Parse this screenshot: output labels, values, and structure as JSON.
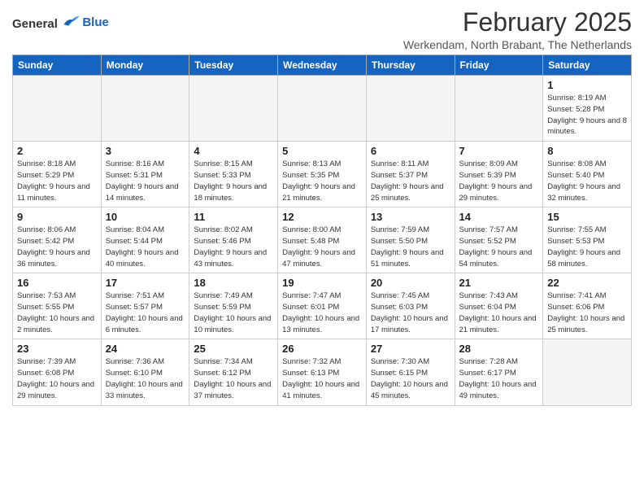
{
  "header": {
    "logo_general": "General",
    "logo_blue": "Blue",
    "month": "February 2025",
    "location": "Werkendam, North Brabant, The Netherlands"
  },
  "days_of_week": [
    "Sunday",
    "Monday",
    "Tuesday",
    "Wednesday",
    "Thursday",
    "Friday",
    "Saturday"
  ],
  "weeks": [
    [
      {
        "day": "",
        "info": ""
      },
      {
        "day": "",
        "info": ""
      },
      {
        "day": "",
        "info": ""
      },
      {
        "day": "",
        "info": ""
      },
      {
        "day": "",
        "info": ""
      },
      {
        "day": "",
        "info": ""
      },
      {
        "day": "1",
        "info": "Sunrise: 8:19 AM\nSunset: 5:28 PM\nDaylight: 9 hours and 8 minutes."
      }
    ],
    [
      {
        "day": "2",
        "info": "Sunrise: 8:18 AM\nSunset: 5:29 PM\nDaylight: 9 hours and 11 minutes."
      },
      {
        "day": "3",
        "info": "Sunrise: 8:16 AM\nSunset: 5:31 PM\nDaylight: 9 hours and 14 minutes."
      },
      {
        "day": "4",
        "info": "Sunrise: 8:15 AM\nSunset: 5:33 PM\nDaylight: 9 hours and 18 minutes."
      },
      {
        "day": "5",
        "info": "Sunrise: 8:13 AM\nSunset: 5:35 PM\nDaylight: 9 hours and 21 minutes."
      },
      {
        "day": "6",
        "info": "Sunrise: 8:11 AM\nSunset: 5:37 PM\nDaylight: 9 hours and 25 minutes."
      },
      {
        "day": "7",
        "info": "Sunrise: 8:09 AM\nSunset: 5:39 PM\nDaylight: 9 hours and 29 minutes."
      },
      {
        "day": "8",
        "info": "Sunrise: 8:08 AM\nSunset: 5:40 PM\nDaylight: 9 hours and 32 minutes."
      }
    ],
    [
      {
        "day": "9",
        "info": "Sunrise: 8:06 AM\nSunset: 5:42 PM\nDaylight: 9 hours and 36 minutes."
      },
      {
        "day": "10",
        "info": "Sunrise: 8:04 AM\nSunset: 5:44 PM\nDaylight: 9 hours and 40 minutes."
      },
      {
        "day": "11",
        "info": "Sunrise: 8:02 AM\nSunset: 5:46 PM\nDaylight: 9 hours and 43 minutes."
      },
      {
        "day": "12",
        "info": "Sunrise: 8:00 AM\nSunset: 5:48 PM\nDaylight: 9 hours and 47 minutes."
      },
      {
        "day": "13",
        "info": "Sunrise: 7:59 AM\nSunset: 5:50 PM\nDaylight: 9 hours and 51 minutes."
      },
      {
        "day": "14",
        "info": "Sunrise: 7:57 AM\nSunset: 5:52 PM\nDaylight: 9 hours and 54 minutes."
      },
      {
        "day": "15",
        "info": "Sunrise: 7:55 AM\nSunset: 5:53 PM\nDaylight: 9 hours and 58 minutes."
      }
    ],
    [
      {
        "day": "16",
        "info": "Sunrise: 7:53 AM\nSunset: 5:55 PM\nDaylight: 10 hours and 2 minutes."
      },
      {
        "day": "17",
        "info": "Sunrise: 7:51 AM\nSunset: 5:57 PM\nDaylight: 10 hours and 6 minutes."
      },
      {
        "day": "18",
        "info": "Sunrise: 7:49 AM\nSunset: 5:59 PM\nDaylight: 10 hours and 10 minutes."
      },
      {
        "day": "19",
        "info": "Sunrise: 7:47 AM\nSunset: 6:01 PM\nDaylight: 10 hours and 13 minutes."
      },
      {
        "day": "20",
        "info": "Sunrise: 7:45 AM\nSunset: 6:03 PM\nDaylight: 10 hours and 17 minutes."
      },
      {
        "day": "21",
        "info": "Sunrise: 7:43 AM\nSunset: 6:04 PM\nDaylight: 10 hours and 21 minutes."
      },
      {
        "day": "22",
        "info": "Sunrise: 7:41 AM\nSunset: 6:06 PM\nDaylight: 10 hours and 25 minutes."
      }
    ],
    [
      {
        "day": "23",
        "info": "Sunrise: 7:39 AM\nSunset: 6:08 PM\nDaylight: 10 hours and 29 minutes."
      },
      {
        "day": "24",
        "info": "Sunrise: 7:36 AM\nSunset: 6:10 PM\nDaylight: 10 hours and 33 minutes."
      },
      {
        "day": "25",
        "info": "Sunrise: 7:34 AM\nSunset: 6:12 PM\nDaylight: 10 hours and 37 minutes."
      },
      {
        "day": "26",
        "info": "Sunrise: 7:32 AM\nSunset: 6:13 PM\nDaylight: 10 hours and 41 minutes."
      },
      {
        "day": "27",
        "info": "Sunrise: 7:30 AM\nSunset: 6:15 PM\nDaylight: 10 hours and 45 minutes."
      },
      {
        "day": "28",
        "info": "Sunrise: 7:28 AM\nSunset: 6:17 PM\nDaylight: 10 hours and 49 minutes."
      },
      {
        "day": "",
        "info": ""
      }
    ]
  ]
}
